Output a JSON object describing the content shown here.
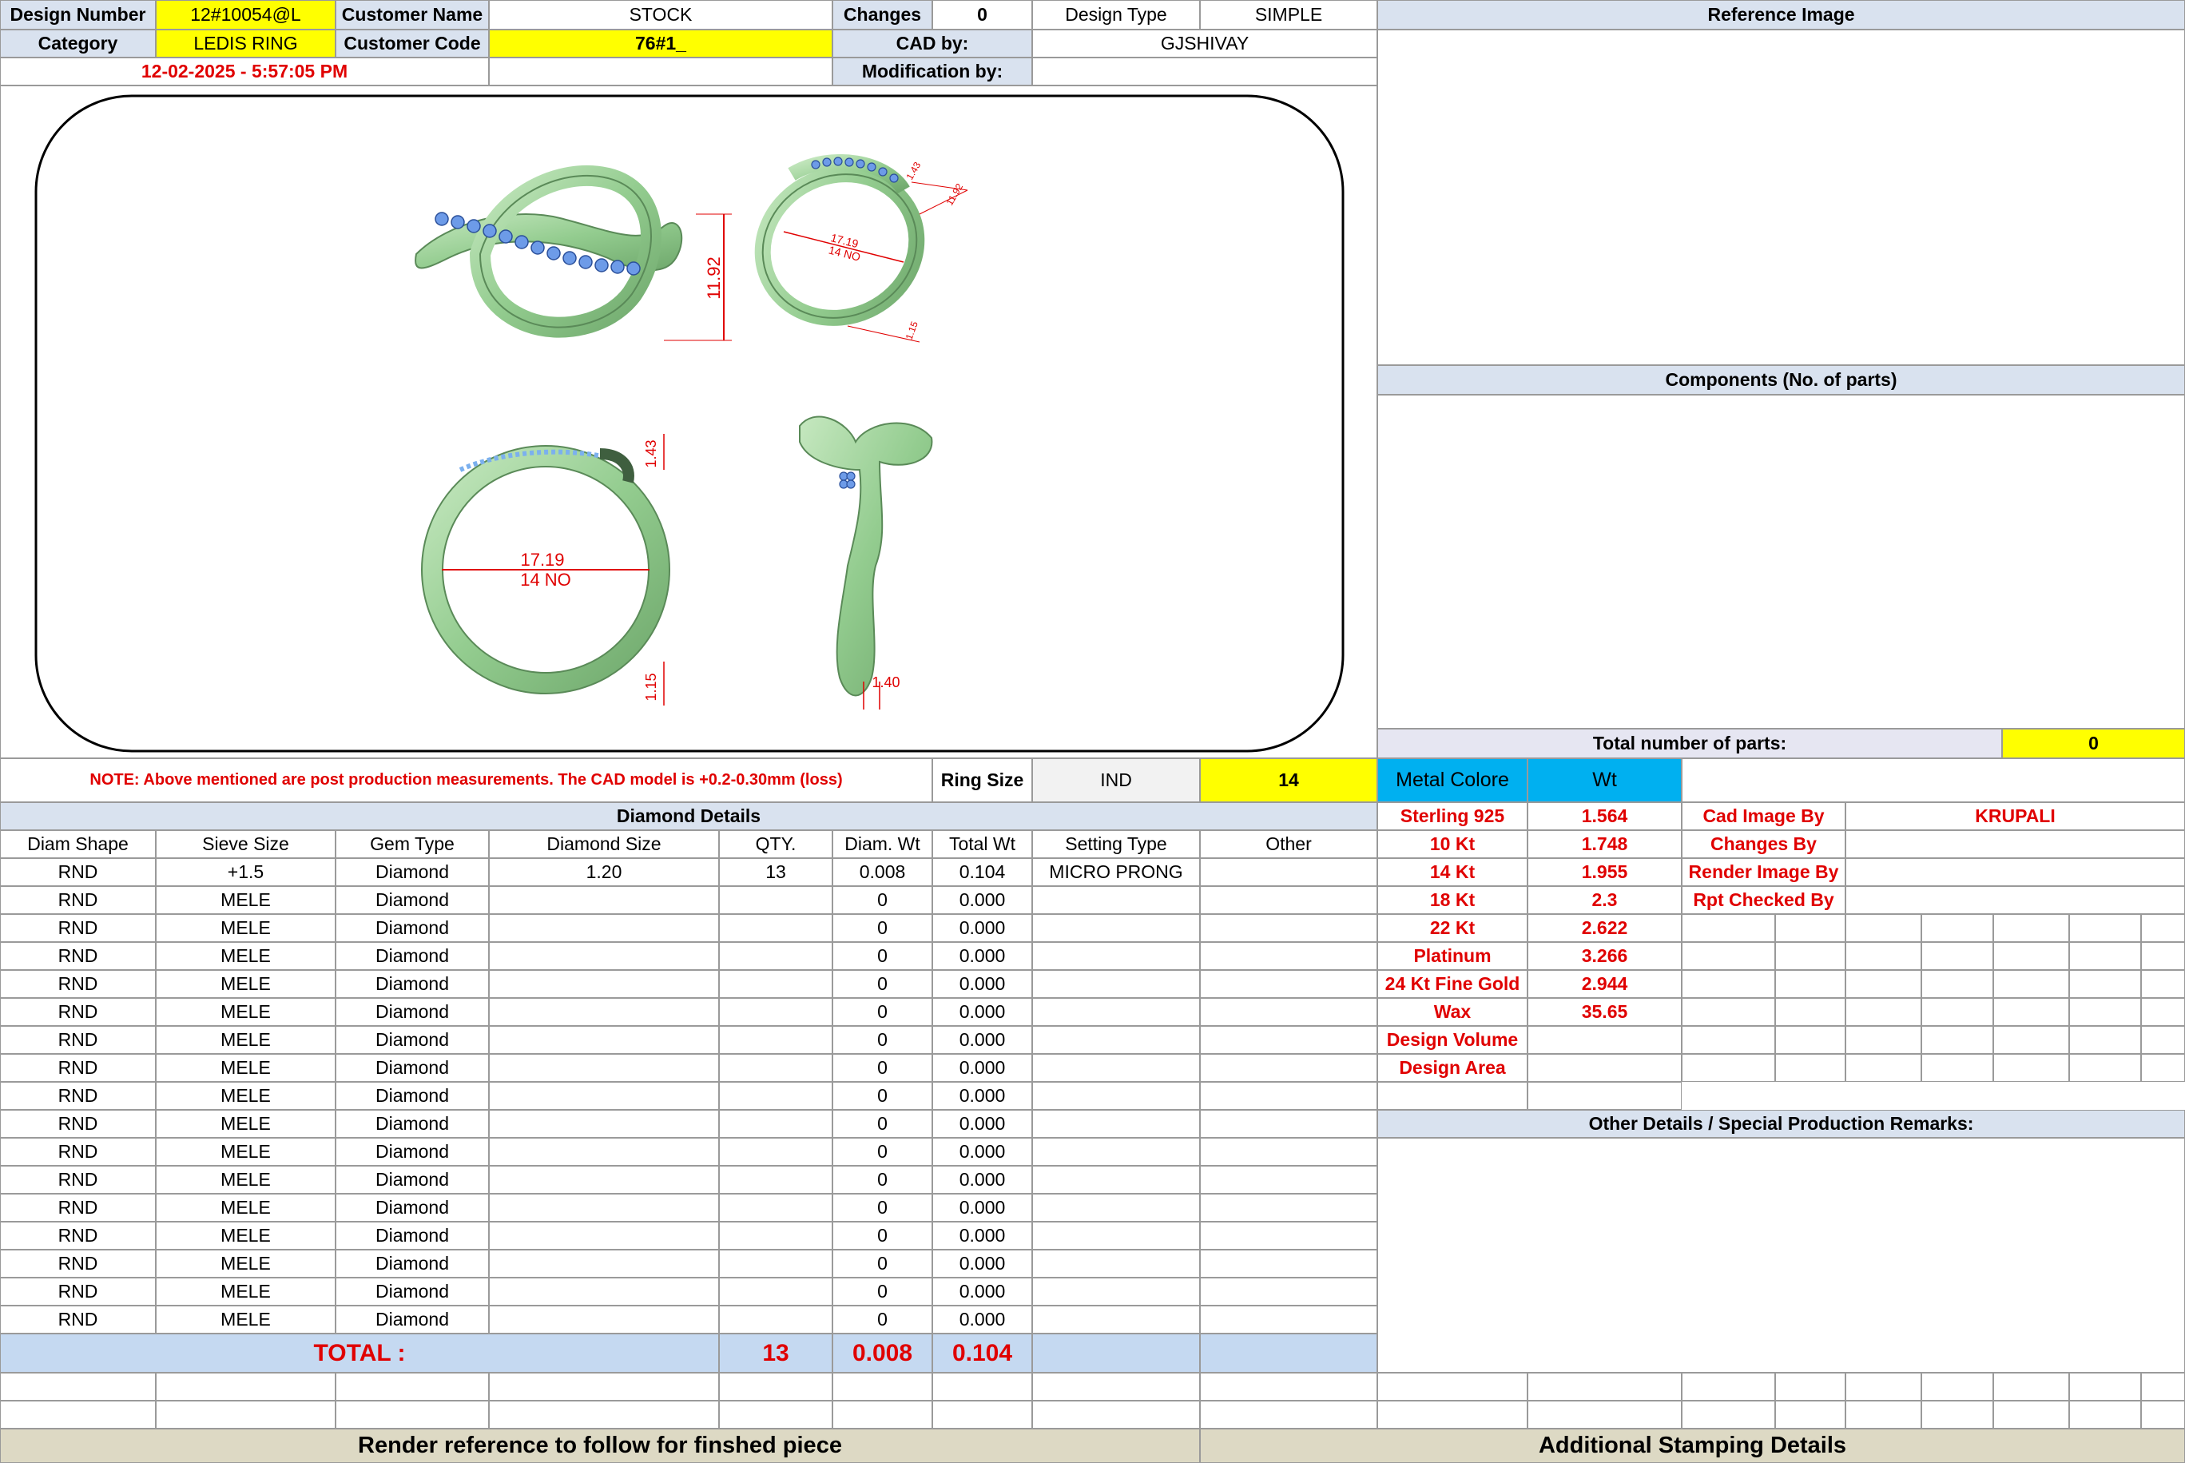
{
  "header": {
    "design_number_label": "Design Number",
    "design_number": "12#10054@L",
    "customer_name_label": "Customer Name",
    "customer_name": "STOCK",
    "changes_label": "Changes",
    "changes": "0",
    "design_type_label": "Design Type",
    "design_type": "SIMPLE",
    "category_label": "Category",
    "category": "LEDIS RING",
    "customer_code_label": "Customer Code",
    "customer_code": "76#1_",
    "cad_by_label": "CAD by:",
    "cad_by": "GJSHIVAY",
    "datetime": "12-02-2025 - 5:57:05 PM",
    "modification_by_label": "Modification by:",
    "modification_by": ""
  },
  "reference_image_label": "Reference Image",
  "components_label": "Components (No. of parts)",
  "total_parts_label": "Total number of parts:",
  "total_parts": "0",
  "drawing": {
    "dim_height": "11.92",
    "dim_width_top": "1.43",
    "dim_diameter": "17.19",
    "dim_size": "14 NO",
    "dim_bottom": "1.15",
    "dim_side_bottom": "1.40",
    "dim_small_a": "1.43",
    "dim_small_b": "11.92",
    "dim_small_c": "1.15"
  },
  "note": "NOTE: Above mentioned are post production measurements. The CAD model is +0.2-0.30mm (loss)",
  "ring_size": {
    "label": "Ring Size",
    "standard": "IND",
    "value": "14"
  },
  "metal": {
    "label": "Metal Colore",
    "wt_label": "Wt",
    "rows": [
      {
        "name": "Sterling 925",
        "wt": "1.564"
      },
      {
        "name": "10 Kt",
        "wt": "1.748"
      },
      {
        "name": "14 Kt",
        "wt": "1.955"
      },
      {
        "name": "18 Kt",
        "wt": "2.3"
      },
      {
        "name": "22 Kt",
        "wt": "2.622"
      },
      {
        "name": "Platinum",
        "wt": "3.266"
      },
      {
        "name": "24 Kt Fine Gold",
        "wt": "2.944"
      },
      {
        "name": "Wax",
        "wt": "35.65"
      },
      {
        "name": "Design Volume",
        "wt": ""
      },
      {
        "name": "Design Area",
        "wt": ""
      }
    ]
  },
  "credits": {
    "cad_image_by_label": "Cad Image By",
    "cad_image_by": "KRUPALI",
    "changes_by_label": "Changes By",
    "render_image_by_label": "Render Image By",
    "rpt_checked_by_label": "Rpt Checked By"
  },
  "other_details_label": "Other Details / Special Production Remarks:",
  "diamond": {
    "title": "Diamond Details",
    "columns": [
      "Diam Shape",
      "Sieve Size",
      "Gem Type",
      "Diamond Size",
      "QTY.",
      "Diam. Wt",
      "Total Wt",
      "Setting Type",
      "Other"
    ],
    "rows": [
      [
        "RND",
        "+1.5",
        "Diamond",
        "1.20",
        "13",
        "0.008",
        "0.104",
        "MICRO PRONG",
        ""
      ],
      [
        "RND",
        "MELE",
        "Diamond",
        "",
        "",
        "0",
        "0.000",
        "",
        ""
      ],
      [
        "RND",
        "MELE",
        "Diamond",
        "",
        "",
        "0",
        "0.000",
        "",
        ""
      ],
      [
        "RND",
        "MELE",
        "Diamond",
        "",
        "",
        "0",
        "0.000",
        "",
        ""
      ],
      [
        "RND",
        "MELE",
        "Diamond",
        "",
        "",
        "0",
        "0.000",
        "",
        ""
      ],
      [
        "RND",
        "MELE",
        "Diamond",
        "",
        "",
        "0",
        "0.000",
        "",
        ""
      ],
      [
        "RND",
        "MELE",
        "Diamond",
        "",
        "",
        "0",
        "0.000",
        "",
        ""
      ],
      [
        "RND",
        "MELE",
        "Diamond",
        "",
        "",
        "0",
        "0.000",
        "",
        ""
      ],
      [
        "RND",
        "MELE",
        "Diamond",
        "",
        "",
        "0",
        "0.000",
        "",
        ""
      ],
      [
        "RND",
        "MELE",
        "Diamond",
        "",
        "",
        "0",
        "0.000",
        "",
        ""
      ],
      [
        "RND",
        "MELE",
        "Diamond",
        "",
        "",
        "0",
        "0.000",
        "",
        ""
      ],
      [
        "RND",
        "MELE",
        "Diamond",
        "",
        "",
        "0",
        "0.000",
        "",
        ""
      ],
      [
        "RND",
        "MELE",
        "Diamond",
        "",
        "",
        "0",
        "0.000",
        "",
        ""
      ],
      [
        "RND",
        "MELE",
        "Diamond",
        "",
        "",
        "0",
        "0.000",
        "",
        ""
      ],
      [
        "RND",
        "MELE",
        "Diamond",
        "",
        "",
        "0",
        "0.000",
        "",
        ""
      ],
      [
        "RND",
        "MELE",
        "Diamond",
        "",
        "",
        "0",
        "0.000",
        "",
        ""
      ],
      [
        "RND",
        "MELE",
        "Diamond",
        "",
        "",
        "0",
        "0.000",
        "",
        ""
      ]
    ],
    "total_label": "TOTAL :",
    "total_qty": "13",
    "total_diam_wt": "0.008",
    "total_wt": "0.104"
  },
  "footer": {
    "render_reference": "Render reference to follow for finshed piece",
    "stamping": "Additional Stamping Details"
  },
  "colors": {
    "header_bg": "#d9e2ef",
    "highlight": "#ffff00",
    "accent_red": "#e00000",
    "metal_header": "#00b0f0",
    "ring_metal": "#9cd39c"
  }
}
